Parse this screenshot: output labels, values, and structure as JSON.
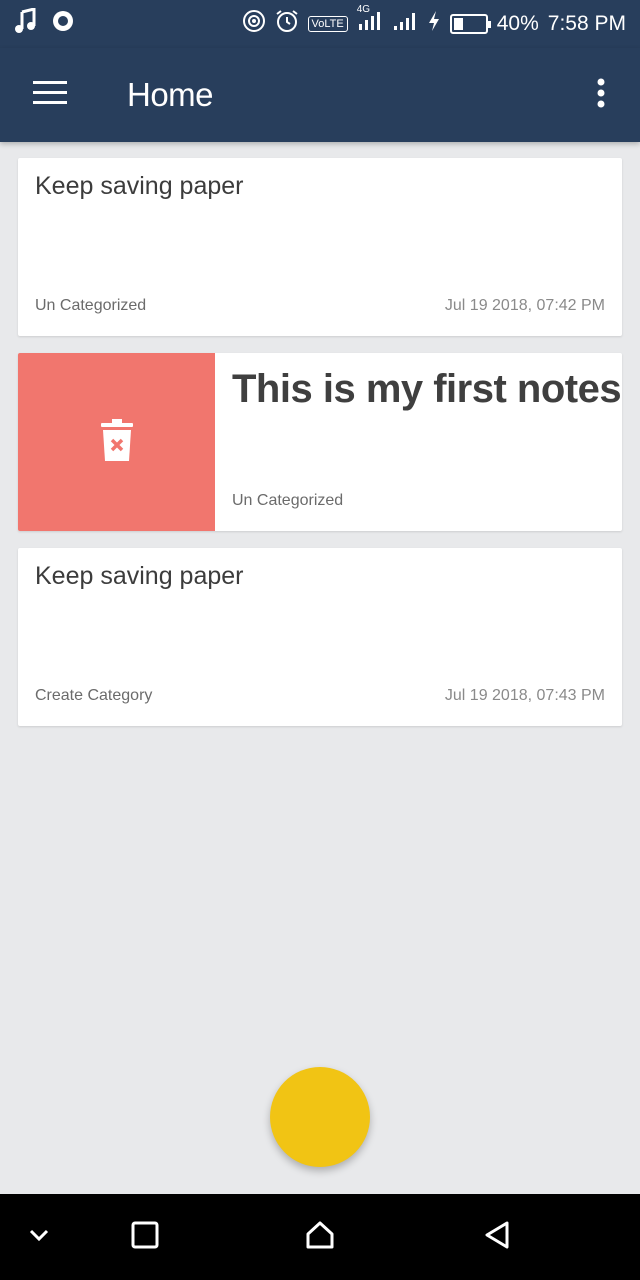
{
  "status_bar": {
    "volte": "VoLTE",
    "network": "4G",
    "battery": "40%",
    "battery_level": 0.4,
    "time": "7:58 PM",
    "icons": [
      "music-icon",
      "record-icon",
      "hotspot-icon",
      "alarm-icon",
      "signal-icon",
      "charging-icon",
      "battery-icon"
    ]
  },
  "app_bar": {
    "title": "Home",
    "background": "#283e5c",
    "icons": [
      "menu-icon",
      "more-vert-icon"
    ]
  },
  "notes": [
    {
      "title": "Keep saving paper",
      "category": "Un Categorized",
      "date": "Jul 19 2018, 07:42 PM"
    },
    {
      "title": "This is my first notes",
      "category": "Un Categorized",
      "swiped": true,
      "delete_color": "#f1766e",
      "icon": "delete-icon"
    },
    {
      "title": "Keep saving paper",
      "category": "Create Category",
      "date": "Jul 19 2018, 07:43 PM"
    }
  ],
  "fab": {
    "color": "#f1c414"
  },
  "nav_bar": {
    "icons": [
      "collapse-icon",
      "recents-icon",
      "home-icon",
      "back-icon"
    ]
  }
}
